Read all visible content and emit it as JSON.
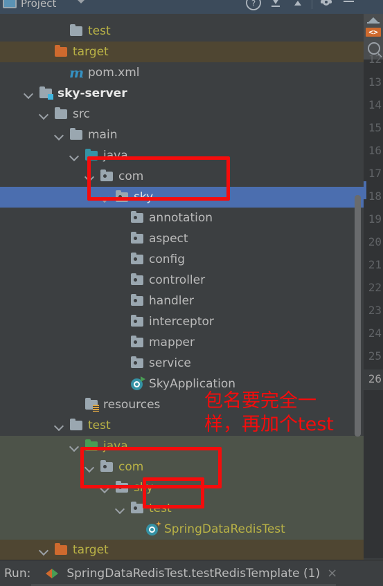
{
  "toolwindow": {
    "title": "Project",
    "icons": [
      "project-icon",
      "chevron-down-icon",
      "help-icon",
      "collapse-all-icon",
      "expand-all-icon",
      "settings-gear-icon",
      "hide-icon"
    ]
  },
  "tree": {
    "rows": [
      {
        "label": "test",
        "indent": 3,
        "arrow": "right",
        "icon": "folder-gray",
        "color": "yellow",
        "bg": "none",
        "bold": false
      },
      {
        "label": "target",
        "indent": 2,
        "arrow": "right",
        "icon": "folder-orange",
        "color": "yellow",
        "bg": "excluded",
        "bold": false
      },
      {
        "label": "pom.xml",
        "indent": 3,
        "arrow": "none",
        "icon": "maven-file",
        "color": "gray",
        "bg": "none",
        "bold": false
      },
      {
        "label": "sky-server",
        "indent": 1,
        "arrow": "down",
        "icon": "module-gray",
        "color": "white",
        "bg": "none",
        "bold": true
      },
      {
        "label": "src",
        "indent": 2,
        "arrow": "down",
        "icon": "folder-gray",
        "color": "gray",
        "bg": "none",
        "bold": false
      },
      {
        "label": "main",
        "indent": 3,
        "arrow": "down",
        "icon": "folder-gray",
        "color": "gray",
        "bg": "none",
        "bold": false
      },
      {
        "label": "java",
        "indent": 4,
        "arrow": "down",
        "icon": "folder-teal",
        "color": "gray",
        "bg": "none",
        "bold": false
      },
      {
        "label": "com",
        "indent": 5,
        "arrow": "down",
        "icon": "package",
        "color": "gray",
        "bg": "none",
        "bold": false
      },
      {
        "label": "sky",
        "indent": 6,
        "arrow": "down",
        "icon": "package",
        "color": "sel",
        "bg": "selected",
        "bold": false
      },
      {
        "label": "annotation",
        "indent": 7,
        "arrow": "right",
        "icon": "package",
        "color": "gray",
        "bg": "none",
        "bold": false
      },
      {
        "label": "aspect",
        "indent": 7,
        "arrow": "right",
        "icon": "package",
        "color": "gray",
        "bg": "none",
        "bold": false
      },
      {
        "label": "config",
        "indent": 7,
        "arrow": "right",
        "icon": "package",
        "color": "gray",
        "bg": "none",
        "bold": false
      },
      {
        "label": "controller",
        "indent": 7,
        "arrow": "right",
        "icon": "package",
        "color": "gray",
        "bg": "none",
        "bold": false
      },
      {
        "label": "handler",
        "indent": 7,
        "arrow": "right",
        "icon": "package",
        "color": "gray",
        "bg": "none",
        "bold": false
      },
      {
        "label": "interceptor",
        "indent": 7,
        "arrow": "right",
        "icon": "package",
        "color": "gray",
        "bg": "none",
        "bold": false
      },
      {
        "label": "mapper",
        "indent": 7,
        "arrow": "right",
        "icon": "package",
        "color": "gray",
        "bg": "none",
        "bold": false
      },
      {
        "label": "service",
        "indent": 7,
        "arrow": "right",
        "icon": "package",
        "color": "gray",
        "bg": "none",
        "bold": false
      },
      {
        "label": "SkyApplication",
        "indent": 7,
        "arrow": "none",
        "icon": "spring-class",
        "color": "gray",
        "bg": "none",
        "bold": false
      },
      {
        "label": "resources",
        "indent": 4,
        "arrow": "right",
        "icon": "resources-root",
        "color": "gray",
        "bg": "none",
        "bold": false
      },
      {
        "label": "test",
        "indent": 3,
        "arrow": "down",
        "icon": "folder-gray",
        "color": "yellow",
        "bg": "none",
        "bold": false
      },
      {
        "label": "java",
        "indent": 4,
        "arrow": "down",
        "icon": "folder-green",
        "color": "yellow",
        "bg": "testroot",
        "bold": false
      },
      {
        "label": "com",
        "indent": 5,
        "arrow": "down",
        "icon": "package",
        "color": "yellow",
        "bg": "testroot",
        "bold": false
      },
      {
        "label": "sky",
        "indent": 6,
        "arrow": "down",
        "icon": "package",
        "color": "yellow",
        "bg": "testroot",
        "bold": false
      },
      {
        "label": "test",
        "indent": 7,
        "arrow": "down",
        "icon": "package",
        "color": "yellow",
        "bg": "testroot",
        "bold": false
      },
      {
        "label": "SpringDataRedisTest",
        "indent": 8,
        "arrow": "none",
        "icon": "test-class",
        "color": "yellow",
        "bg": "testroot",
        "bold": false
      },
      {
        "label": "target",
        "indent": 2,
        "arrow": "down",
        "icon": "folder-orange",
        "color": "yellow",
        "bg": "excluded",
        "bold": false
      }
    ]
  },
  "editor": {
    "line_numbers": [
      "12",
      "13",
      "14",
      "15",
      "16",
      "17",
      "18",
      "19",
      "20",
      "21",
      "22",
      "23",
      "24",
      "25",
      "26"
    ],
    "current_line": "26",
    "toolbar_icons": [
      "deploy-icon",
      "code-tag-icon",
      "search-icon"
    ]
  },
  "runbar": {
    "label": "Run:",
    "config_name": "SpringDataRedisTest.testRedisTemplate (1)",
    "close_glyph": "×",
    "run-icon": "run-debug-icon"
  },
  "annotations": {
    "note_line1": "包名要完全一",
    "note_line2": "样，再加个test",
    "color": "#f50c0c"
  }
}
